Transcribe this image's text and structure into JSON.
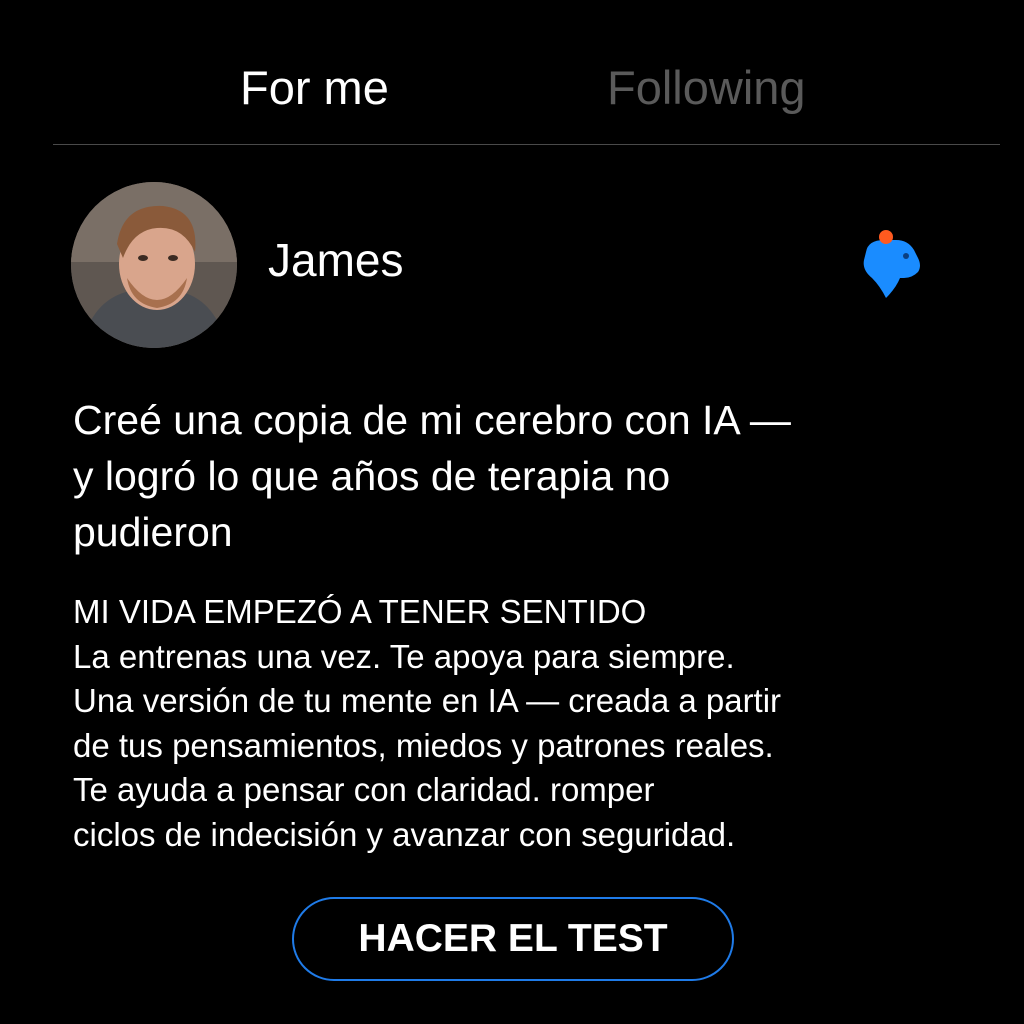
{
  "tabs": {
    "active": "For me",
    "inactive": "Following"
  },
  "post": {
    "author": "James",
    "brand_icon": "capybara-logo-icon",
    "headline_lines": [
      "Creé una copia de mi cerebro con IA —",
      "y logró lo que años de terapia no",
      "pudieron"
    ],
    "body_lines": [
      "MI VIDA EMPEZÓ A TENER SENTIDO",
      "La entrenas una vez. Te apoya para siempre.",
      "Una versión de tu mente en IA — creada a partir",
      "de tus pensamientos, miedos y patrones reales.",
      "Te ayuda a pensar con claridad. romper",
      "ciclos de indecisión y avanzar con seguridad."
    ],
    "cta_label": "HACER EL TEST"
  },
  "colors": {
    "background": "#000000",
    "text": "#ffffff",
    "inactive_tab": "#5a5a5a",
    "accent_blue": "#1f7be8",
    "logo_blue": "#1a8cff",
    "logo_dot": "#ff5a1f"
  }
}
